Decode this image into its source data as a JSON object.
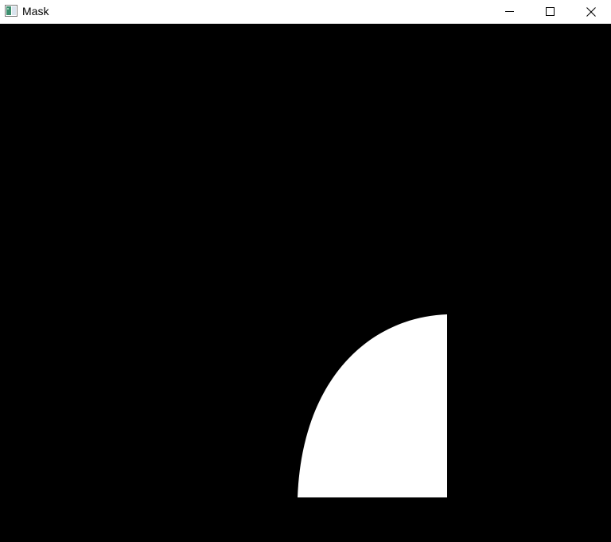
{
  "window": {
    "title": "Mask",
    "icons": {
      "app": "image-window-icon",
      "minimize": "minimize-icon",
      "maximize": "maximize-icon",
      "close": "close-icon"
    }
  },
  "mask_image": {
    "background_color": "#000000",
    "foreground_color": "#ffffff",
    "shape": "quarter-circle"
  }
}
